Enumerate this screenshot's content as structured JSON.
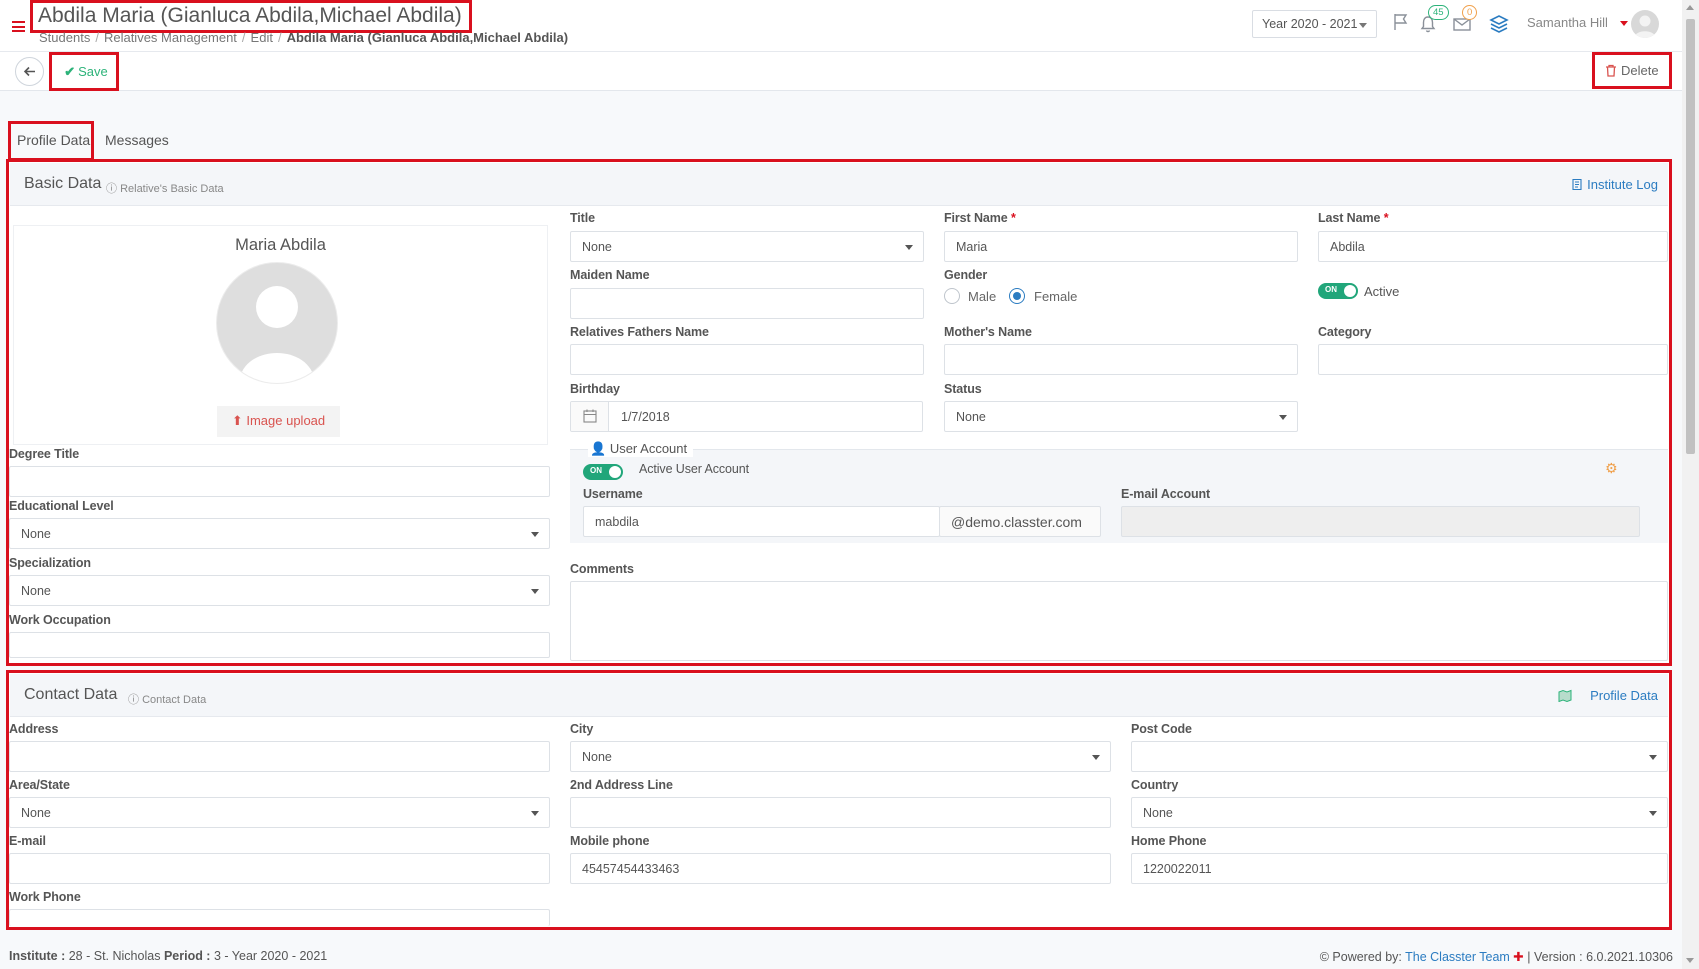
{
  "header": {
    "title": "Abdila Maria (Gianluca Abdila,Michael Abdila)",
    "breadcrumb": [
      "Students",
      "Relatives Management",
      "Edit"
    ],
    "breadcrumb_current": "Abdila Maria (Gianluca Abdila,Michael Abdila)",
    "year": "Year 2020 - 2021",
    "notifications_count": "45",
    "messages_count": "0",
    "user_name": "Samantha Hill"
  },
  "toolbar": {
    "save_label": "Save",
    "delete_label": "Delete"
  },
  "tabs": [
    "Profile Data",
    "Messages"
  ],
  "basic": {
    "title": "Basic Data",
    "subtitle": "Relative's Basic Data",
    "log_link": "Institute Log",
    "profile_name": "Maria Abdila",
    "upload_label": "Image upload",
    "degree_title_label": "Degree Title",
    "educational_level_label": "Educational Level",
    "educational_level_value": "None",
    "specialization_label": "Specialization",
    "specialization_value": "None",
    "work_occupation_label": "Work Occupation",
    "title_label": "Title",
    "title_value": "None",
    "first_name_label": "First Name",
    "first_name_value": "Maria",
    "last_name_label": "Last Name",
    "last_name_value": "Abdila",
    "maiden_name_label": "Maiden Name",
    "gender_label": "Gender",
    "gender_male": "Male",
    "gender_female": "Female",
    "active_label": "Active",
    "fathers_name_label": "Relatives Fathers Name",
    "mothers_name_label": "Mother's Name",
    "category_label": "Category",
    "birthday_label": "Birthday",
    "birthday_value": "1/7/2018",
    "status_label": "Status",
    "status_value": "None",
    "user_account_legend": "User Account",
    "active_user_account_label": "Active User Account",
    "username_label": "Username",
    "username_value": "mabdila",
    "username_domain": "@demo.classter.com",
    "email_account_label": "E-mail Account",
    "comments_label": "Comments",
    "toggle_on": "ON"
  },
  "contact": {
    "title": "Contact Data",
    "subtitle": "Contact Data",
    "profile_link": "Profile Data",
    "address_label": "Address",
    "city_label": "City",
    "city_value": "None",
    "post_code_label": "Post Code",
    "area_label": "Area/State",
    "area_value": "None",
    "address2_label": "2nd Address Line",
    "country_label": "Country",
    "country_value": "None",
    "email_label": "E-mail",
    "mobile_label": "Mobile phone",
    "mobile_value": "45457454433463",
    "home_phone_label": "Home Phone",
    "home_phone_value": "1220022011",
    "work_phone_label": "Work Phone"
  },
  "footer": {
    "institute_label": "Institute :",
    "institute_value": "28 - St. Nicholas",
    "period_label": "Period :",
    "period_value": "3 - Year 2020 - 2021",
    "powered_by": "Powered by:",
    "team": "The Classter Team",
    "version": "| Version : 6.0.2021.10306"
  },
  "colors": {
    "accent": "#2b7cc1",
    "save": "#2db37a",
    "highlight": "#d9101e",
    "toggle": "#21a67a"
  }
}
